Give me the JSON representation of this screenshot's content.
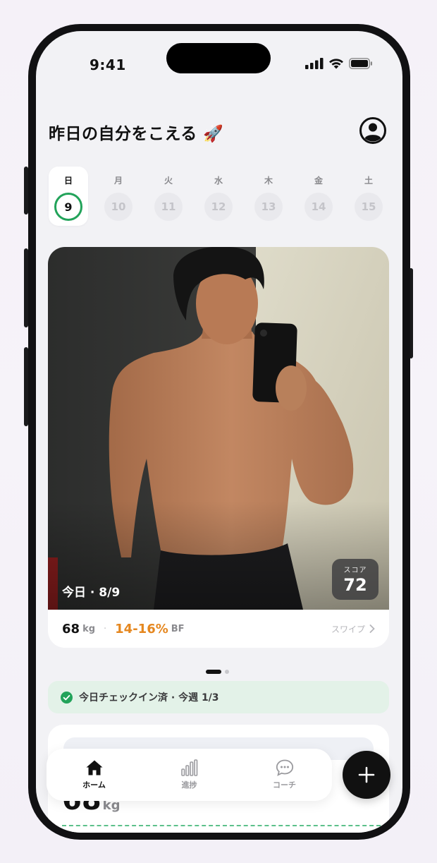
{
  "status_bar": {
    "time": "9:41"
  },
  "header": {
    "title": "昨日の自分をこえる 🚀"
  },
  "week": [
    {
      "label": "日",
      "date": "9",
      "active": true
    },
    {
      "label": "月",
      "date": "10",
      "active": false
    },
    {
      "label": "火",
      "date": "11",
      "active": false
    },
    {
      "label": "水",
      "date": "12",
      "active": false
    },
    {
      "label": "木",
      "date": "13",
      "active": false
    },
    {
      "label": "金",
      "date": "14",
      "active": false
    },
    {
      "label": "土",
      "date": "15",
      "active": false
    }
  ],
  "photo_card": {
    "date_label": "今日 · 8/9",
    "score_label": "スコア",
    "score_value": "72",
    "weight": "68",
    "weight_unit": "kg",
    "separator": "·",
    "bodyfat": "14-16%",
    "bodyfat_unit": "BF",
    "swipe_label": "スワイプ"
  },
  "checkin": {
    "text": "今日チェックイン済 · 今週 1/3"
  },
  "lower_card": {
    "weight": "68",
    "unit": "kg"
  },
  "tabs": [
    {
      "label": "ホーム",
      "icon": "home-icon",
      "active": true
    },
    {
      "label": "進捗",
      "icon": "chart-icon",
      "active": false
    },
    {
      "label": "コーチ",
      "icon": "chat-icon",
      "active": false
    }
  ],
  "colors": {
    "accent_green": "#22a35a",
    "bodyfat_orange": "#e5871f",
    "checkin_bg": "#e3f2e8"
  }
}
